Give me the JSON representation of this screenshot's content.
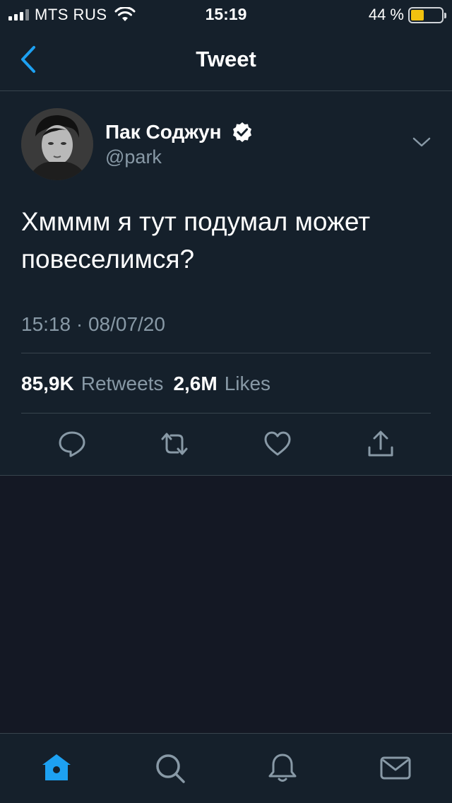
{
  "status_bar": {
    "carrier": "MTS RUS",
    "time": "15:19",
    "battery_percent": "44 %",
    "battery_level": 0.44
  },
  "nav": {
    "title": "Tweet"
  },
  "tweet": {
    "display_name": "Пак Соджун",
    "handle": "@park",
    "text": "Хмммм я тут подумал может повеселимся?",
    "timestamp": "15:18 · 08/07/20",
    "retweets_count": "85,9K",
    "retweets_label": "Retweets",
    "likes_count": "2,6M",
    "likes_label": "Likes"
  },
  "icons": {
    "back": "chevron-left-icon",
    "verified": "verified-badge-icon",
    "more": "chevron-down-icon",
    "reply": "reply-icon",
    "retweet": "retweet-icon",
    "like": "heart-icon",
    "share": "share-icon",
    "home": "home-icon",
    "search": "search-icon",
    "notifications": "bell-icon",
    "messages": "mail-icon"
  },
  "colors": {
    "accent": "#1da1f2",
    "background": "#15202b",
    "secondary_text": "#8899a6",
    "battery": "#f2c20f"
  }
}
